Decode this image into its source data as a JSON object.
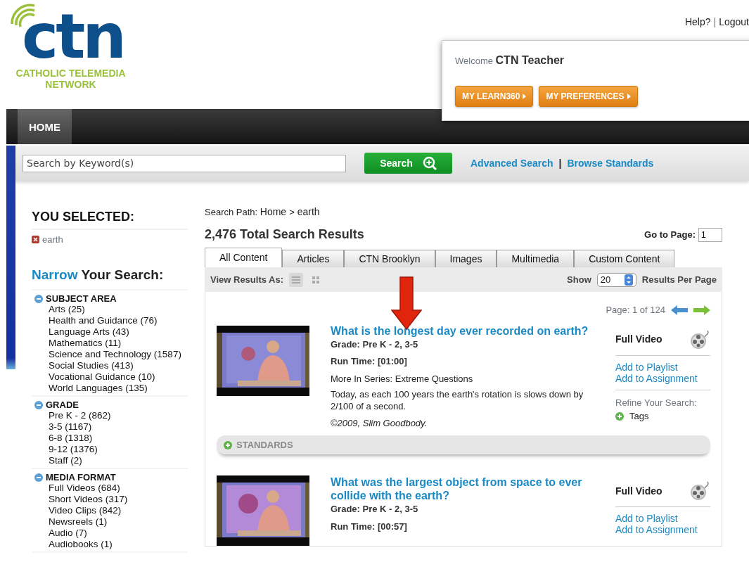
{
  "header": {
    "logo": {
      "mark": "ctn",
      "name": "CATHOLIC TELEMEDIA NETWORK"
    },
    "top_links": [
      "Help?",
      "Logout"
    ],
    "link_separator": "|",
    "welcome": {
      "label": "Welcome",
      "user": "CTN Teacher",
      "buttons": [
        "MY LEARN360",
        "MY PREFERENCES"
      ]
    }
  },
  "nav": [
    {
      "label": "HOME",
      "selected": true
    }
  ],
  "search": {
    "placeholder": "Search by Keyword(s)",
    "button": "Search",
    "links": [
      "Advanced Search",
      "Browse Standards"
    ],
    "link_separator": "|"
  },
  "sidebar": {
    "selected_title": "YOU SELECTED:",
    "selected": [
      "earth"
    ],
    "narrow_title": {
      "accent": "Narrow",
      "rest": "Your Search:"
    },
    "groups": [
      {
        "title": "SUBJECT AREA",
        "expanded": true,
        "items": [
          "Arts (25)",
          "Health and Guidance (76)",
          "Language Arts (43)",
          "Mathematics (11)",
          "Science and Technology (1587)",
          "Social Studies (413)",
          "Vocational Guidance (10)",
          "World Languages (135)"
        ]
      },
      {
        "title": "GRADE",
        "expanded": true,
        "items": [
          "Pre K - 2 (862)",
          "3-5 (1167)",
          "6-8 (1318)",
          "9-12 (1376)",
          "Staff (2)"
        ]
      },
      {
        "title": "MEDIA FORMAT",
        "expanded": true,
        "items": [
          "Full Videos (684)",
          "Short Videos (317)",
          "Video Clips (842)",
          "Newsreels (1)",
          "Audio (7)",
          "Audiobooks (1)"
        ]
      }
    ]
  },
  "results": {
    "path_label": "Search Path:",
    "path": [
      "Home",
      "earth"
    ],
    "separator": ">",
    "total": "2,476 Total Search Results",
    "goto": {
      "label": "Go to Page:",
      "value": "1"
    },
    "tabs": [
      {
        "label": "All Content",
        "selected": true
      },
      {
        "label": "Articles",
        "selected": false
      },
      {
        "label": "CTN Brooklyn",
        "selected": false
      },
      {
        "label": "Images",
        "selected": false
      },
      {
        "label": "Multimedia",
        "selected": false
      },
      {
        "label": "Custom Content",
        "selected": false
      }
    ],
    "view": {
      "label": "View Results As:",
      "modes": [
        {
          "kind": "list",
          "selected": true
        },
        {
          "kind": "grid",
          "selected": false
        }
      ]
    },
    "show": {
      "label": "Show",
      "value": "20",
      "suffix": "Results Per Page"
    },
    "page": "Page: 1 of 124",
    "items": [
      {
        "title": "What is the longest day ever recorded on earth?",
        "grade": "Grade: Pre K - 2, 3-5",
        "run_time": "Run Time: [01:00]",
        "series_label": "More In Series:",
        "series": "Extreme Questions",
        "description": "Today, as each 100 years the earth's rotation is slows down by 2/100 of a second.",
        "credit": "©2009, Slim Goodbody.",
        "format": "Full Video",
        "actions": [
          "Add to Playlist",
          "Add to Assignment"
        ],
        "refine_label": "Refine Your Search:",
        "refine_tag": "Tags",
        "standards": "STANDARDS"
      },
      {
        "title": "What was the largest object from space to ever collide with the earth?",
        "grade": "Grade: Pre K - 2, 3-5",
        "run_time": "Run Time: [00:57]",
        "format": "Full Video",
        "actions": [
          "Add to Playlist",
          "Add to Assignment"
        ]
      }
    ]
  }
}
